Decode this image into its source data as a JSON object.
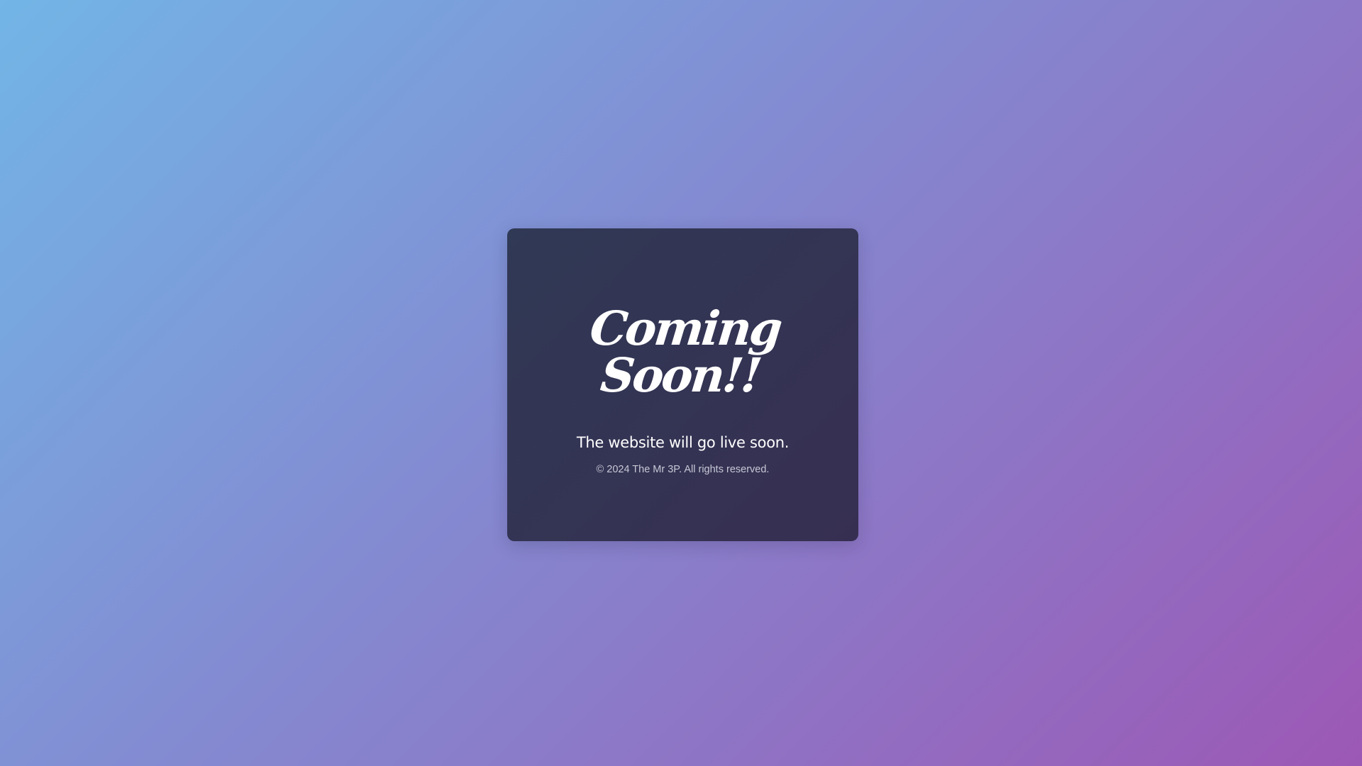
{
  "card": {
    "title": "Coming Soon!!",
    "subtitle": "The website will go live soon.",
    "copyright": "© 2024 The Mr 3P. All rights reserved."
  },
  "colors": {
    "background_start": "#72b5e6",
    "background_mid": "#8489d0",
    "background_end": "#9c58b5",
    "card_background": "#333550",
    "title_text": "#ffffff",
    "copyright_text": "#c7c8d6"
  }
}
